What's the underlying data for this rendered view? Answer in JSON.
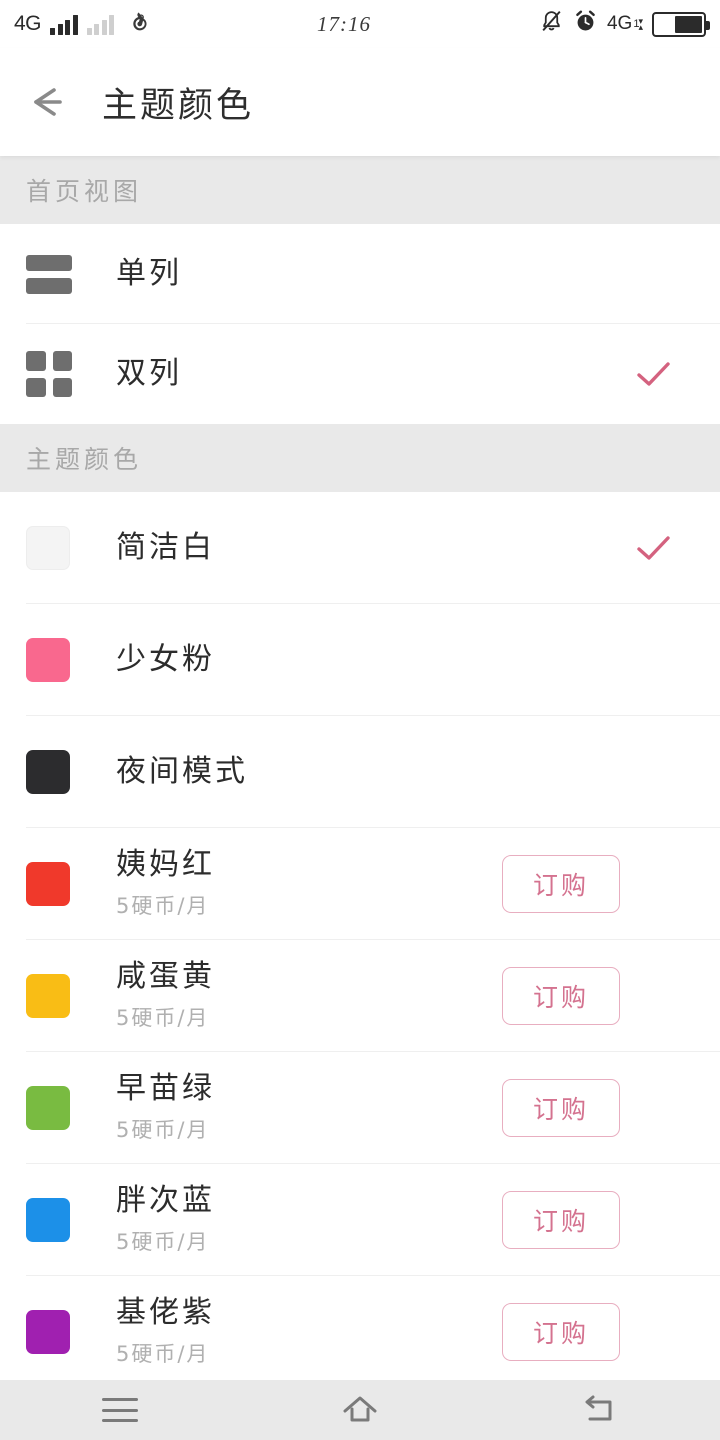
{
  "statusbar": {
    "network_left": "4G",
    "time": "17:16",
    "network_right": "4G",
    "network_right_sub": "1",
    "icons": [
      "signal-bars-icon",
      "signal-bars-dim-icon",
      "netease-music-icon",
      "bell-muted-icon",
      "alarm-clock-icon",
      "data-arrows-icon",
      "battery-icon"
    ]
  },
  "header": {
    "back_label": "back-arrow",
    "title": "主题颜色"
  },
  "sections": [
    {
      "id": "home-view",
      "title": "首页视图",
      "rows": [
        {
          "id": "single-column",
          "label": "单列",
          "icon": "single-column-icon",
          "selected": false
        },
        {
          "id": "double-column",
          "label": "双列",
          "icon": "grid-column-icon",
          "selected": true
        }
      ]
    },
    {
      "id": "theme-color",
      "title": "主题颜色",
      "rows": [
        {
          "id": "clean-white",
          "label": "简洁白",
          "color": "#f4f4f4",
          "selected": true,
          "price": "",
          "action": ""
        },
        {
          "id": "girly-pink",
          "label": "少女粉",
          "color": "#f9688e",
          "selected": false,
          "price": "",
          "action": ""
        },
        {
          "id": "night-mode",
          "label": "夜间模式",
          "color": "#2c2c2e",
          "selected": false,
          "price": "",
          "action": ""
        },
        {
          "id": "auntie-red",
          "label": "姨妈红",
          "color": "#f0392b",
          "selected": false,
          "price": "5硬币/月",
          "action": "订购"
        },
        {
          "id": "salted-yolk-yellow",
          "label": "咸蛋黄",
          "color": "#f9bd15",
          "selected": false,
          "price": "5硬币/月",
          "action": "订购"
        },
        {
          "id": "sanae-green",
          "label": "早苗绿",
          "color": "#79bb41",
          "selected": false,
          "price": "5硬币/月",
          "action": "订购"
        },
        {
          "id": "pantsu-blue",
          "label": "胖次蓝",
          "color": "#1c90e8",
          "selected": false,
          "price": "5硬币/月",
          "action": "订购"
        },
        {
          "id": "gay-purple",
          "label": "基佬紫",
          "color": "#a020b0",
          "selected": false,
          "price": "5硬币/月",
          "action": "订购"
        }
      ]
    }
  ],
  "navbar": {
    "menu": "menu-icon",
    "home": "home-icon",
    "back": "back-icon"
  },
  "colors": {
    "accent_pink": "#d4728f",
    "check_pink": "#d4627f",
    "section_bg": "#e9e9e9",
    "divider": "#efefef"
  }
}
